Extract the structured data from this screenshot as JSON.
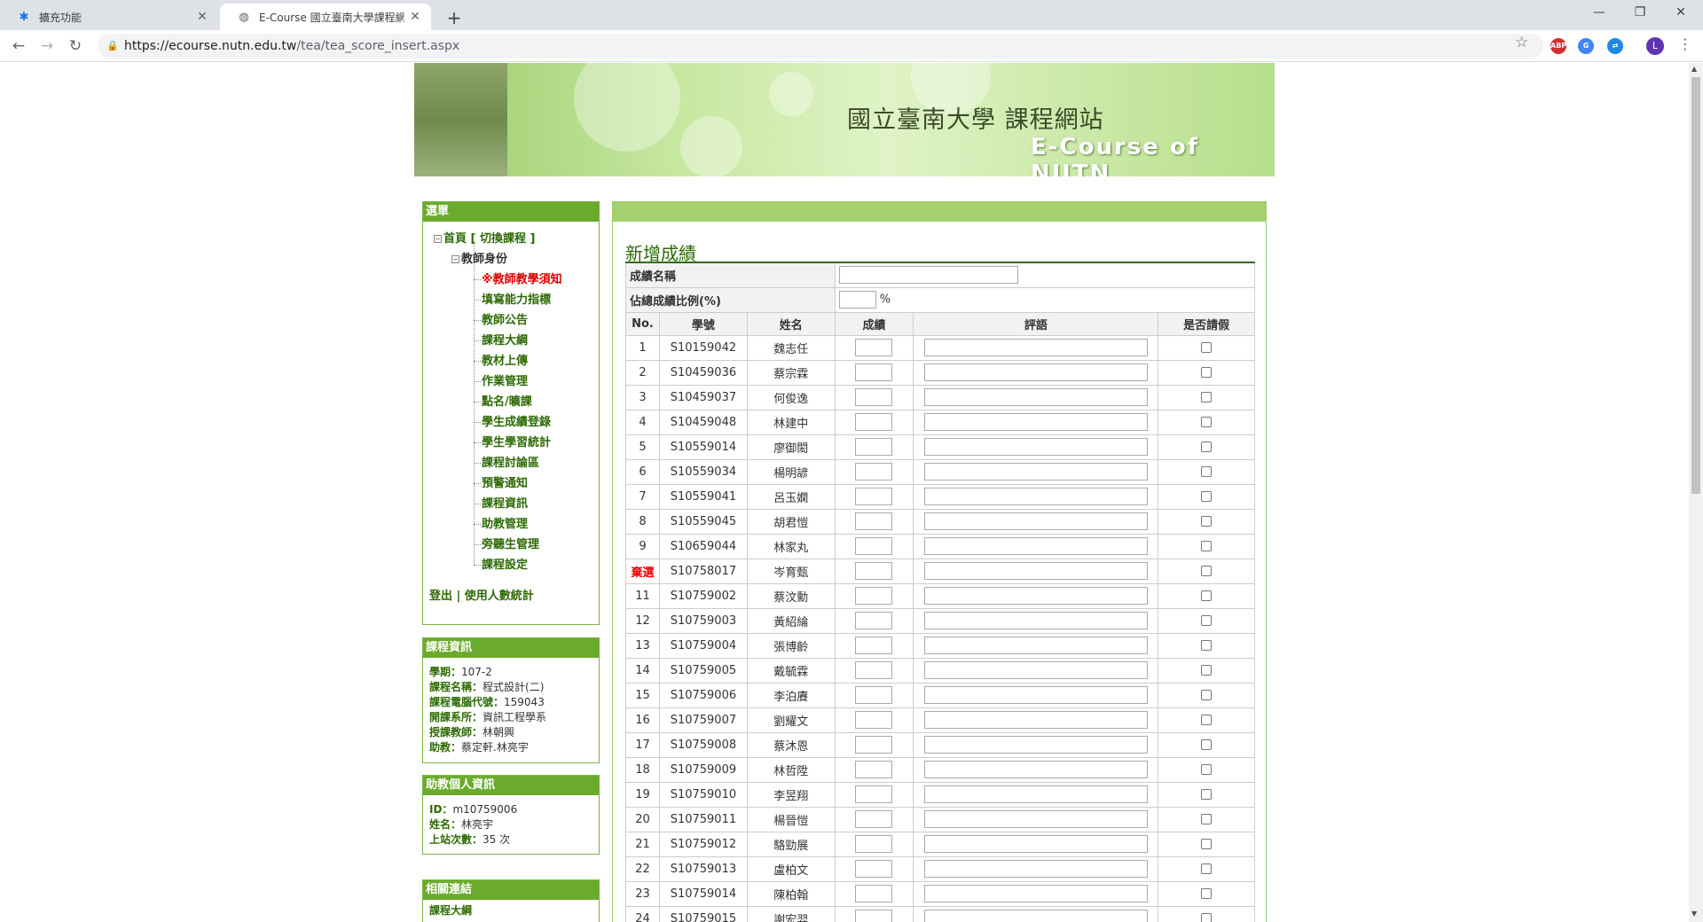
{
  "browser": {
    "tabs": [
      {
        "label": "擴充功能"
      },
      {
        "label": "E-Course 國立臺南大學課程網站"
      }
    ],
    "url_host": "https://ecourse.nutn.edu.tw",
    "url_path": "/tea/tea_score_insert.aspx",
    "profile_initial": "L",
    "extension_abp": "ABP"
  },
  "banner": {
    "title_cn": "國立臺南大學 課程網站",
    "title_en": "E-Course of NUTN"
  },
  "menu": {
    "header": "選單",
    "home": "首頁 [ 切換課程 ]",
    "role": "教師身份",
    "items": [
      "※教師教學須知",
      "填寫能力指標",
      "教師公告",
      "課程大綱",
      "教材上傳",
      "作業管理",
      "點名/曠課",
      "學生成績登錄",
      "學生學習統計",
      "課程討論區",
      "預警通知",
      "課程資訊",
      "助教管理",
      "旁聽生管理",
      "課程設定"
    ],
    "logout": "登出 | 使用人數統計"
  },
  "course_info": {
    "header": "課程資訊",
    "lines": [
      {
        "k": "學期：",
        "v": "107-2"
      },
      {
        "k": "課程名稱：",
        "v": "程式設計(二)"
      },
      {
        "k": "課程電腦代號：",
        "v": "159043"
      },
      {
        "k": "開課系所：",
        "v": "資訊工程學系"
      },
      {
        "k": "授課教師：",
        "v": "林朝興"
      },
      {
        "k": "助教：",
        "v": "蔡定軒.林亮宇"
      }
    ]
  },
  "ta_info": {
    "header": "助教個人資訊",
    "lines": [
      {
        "k": "ID：",
        "v": "m10759006"
      },
      {
        "k": "姓名：",
        "v": "林亮宇"
      },
      {
        "k": "上站次數：",
        "v": "35 次"
      }
    ]
  },
  "links": {
    "header": "相關連結",
    "first": "課程大綱"
  },
  "main": {
    "title": "新增成績",
    "score_name_label": "成績名稱",
    "ratio_label": "佔總成績比例(%)",
    "ratio_unit": "%",
    "columns": [
      "No.",
      "學號",
      "姓名",
      "成績",
      "評語",
      "是否請假"
    ],
    "rows": [
      {
        "no": "1",
        "id": "S10159042",
        "name": "魏志任"
      },
      {
        "no": "2",
        "id": "S10459036",
        "name": "蔡宗霖"
      },
      {
        "no": "3",
        "id": "S10459037",
        "name": "何俊逸"
      },
      {
        "no": "4",
        "id": "S10459048",
        "name": "林建中"
      },
      {
        "no": "5",
        "id": "S10559014",
        "name": "廖御閎"
      },
      {
        "no": "6",
        "id": "S10559034",
        "name": "楊明諺"
      },
      {
        "no": "7",
        "id": "S10559041",
        "name": "呂玉嫻"
      },
      {
        "no": "8",
        "id": "S10559045",
        "name": "胡君愷"
      },
      {
        "no": "9",
        "id": "S10659044",
        "name": "林家丸"
      },
      {
        "no": "棄選",
        "id": "S10758017",
        "name": "岑育甄",
        "dropped": true
      },
      {
        "no": "11",
        "id": "S10759002",
        "name": "蔡汶勳"
      },
      {
        "no": "12",
        "id": "S10759003",
        "name": "黃紹綸"
      },
      {
        "no": "13",
        "id": "S10759004",
        "name": "張博齡"
      },
      {
        "no": "14",
        "id": "S10759005",
        "name": "戴毓霖"
      },
      {
        "no": "15",
        "id": "S10759006",
        "name": "李泊賡"
      },
      {
        "no": "16",
        "id": "S10759007",
        "name": "劉耀文"
      },
      {
        "no": "17",
        "id": "S10759008",
        "name": "蔡沐恩"
      },
      {
        "no": "18",
        "id": "S10759009",
        "name": "林哲陞"
      },
      {
        "no": "19",
        "id": "S10759010",
        "name": "李昱翔"
      },
      {
        "no": "20",
        "id": "S10759011",
        "name": "楊晉愷"
      },
      {
        "no": "21",
        "id": "S10759012",
        "name": "駱勁展"
      },
      {
        "no": "22",
        "id": "S10759013",
        "name": "盧柏文"
      },
      {
        "no": "23",
        "id": "S10759014",
        "name": "陳柏翰"
      },
      {
        "no": "24",
        "id": "S10759015",
        "name": "謝宏羿"
      }
    ]
  }
}
